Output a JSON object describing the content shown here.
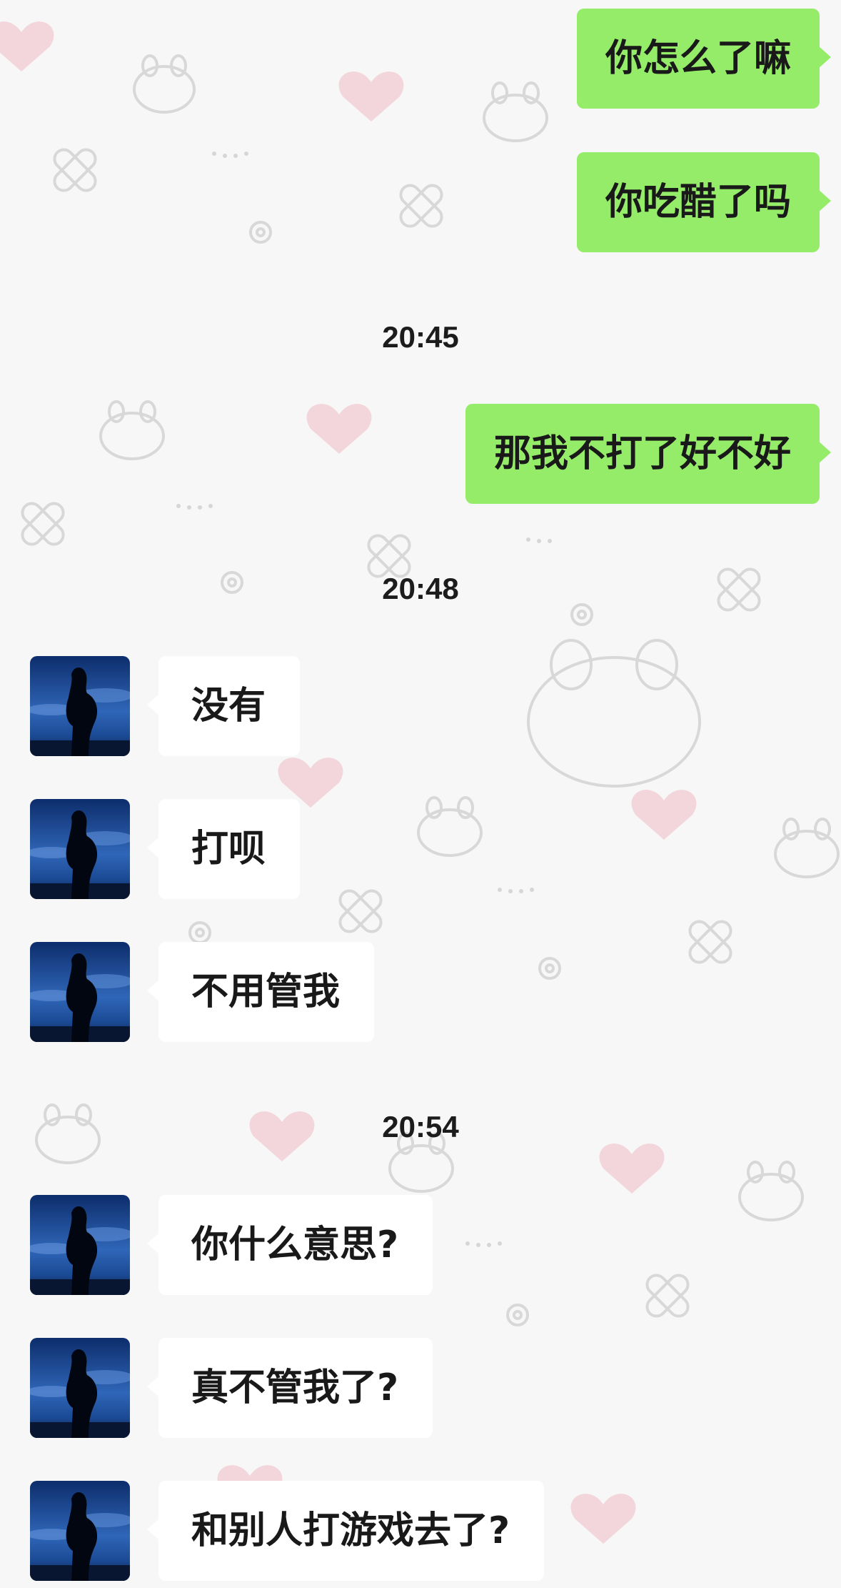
{
  "chat": {
    "messages": [
      {
        "kind": "out",
        "text": "你怎么了嘛"
      },
      {
        "kind": "out",
        "text": "你吃醋了吗"
      },
      {
        "kind": "time",
        "text": "20:45"
      },
      {
        "kind": "out",
        "text": "那我不打了好不好"
      },
      {
        "kind": "time",
        "text": "20:48"
      },
      {
        "kind": "in",
        "text": "没有",
        "avatar": "contact-avatar"
      },
      {
        "kind": "in",
        "text": "打呗",
        "avatar": "contact-avatar"
      },
      {
        "kind": "in",
        "text": "不用管我",
        "avatar": "contact-avatar"
      },
      {
        "kind": "time",
        "text": "20:54"
      },
      {
        "kind": "in",
        "text": "你什么意思?",
        "avatar": "contact-avatar"
      },
      {
        "kind": "in",
        "text": "真不管我了?",
        "avatar": "contact-avatar"
      },
      {
        "kind": "in",
        "text": "和别人打游戏去了?",
        "avatar": "contact-avatar"
      }
    ]
  },
  "colors": {
    "background": "#f7f7f7",
    "outgoing_bubble": "#95ec69",
    "incoming_bubble": "#ffffff",
    "text": "#191919"
  }
}
